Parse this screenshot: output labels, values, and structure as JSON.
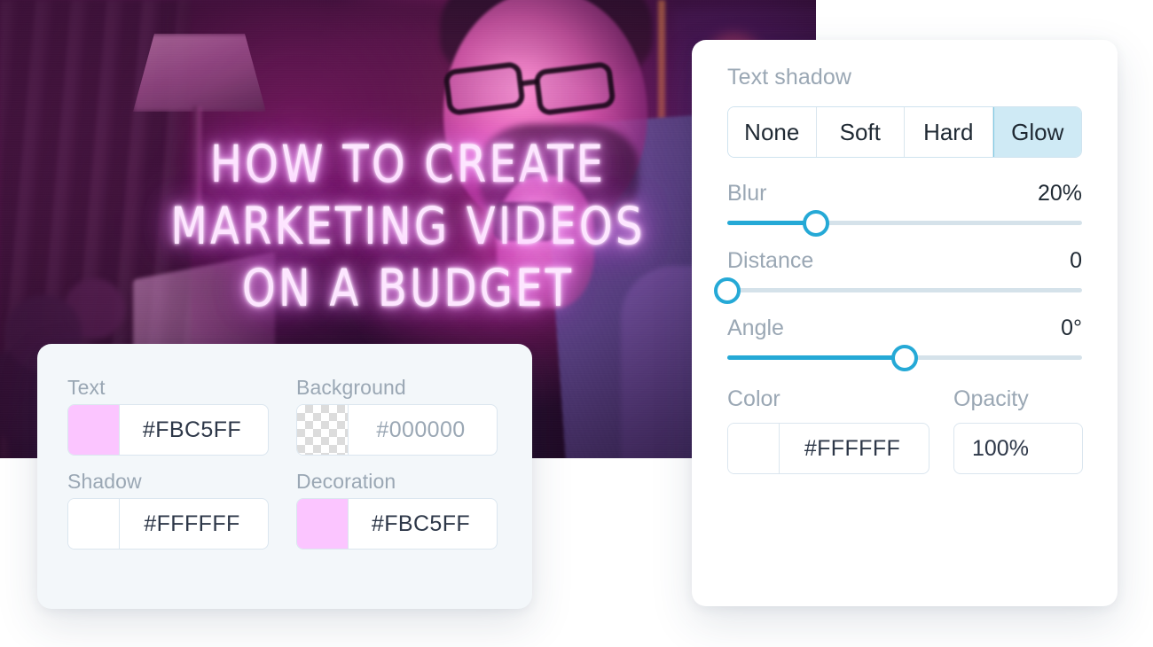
{
  "thumbnail": {
    "headline": "HOW TO CREATE\nMARKETING VIDEOS\nON A BUDGET",
    "headline_color": "#FBC5FF"
  },
  "color_panel": {
    "fields": [
      {
        "label": "Text",
        "value": "#FBC5FF",
        "swatch": "#FBC5FF",
        "swatch_kind": "solid",
        "placeholder": false
      },
      {
        "label": "Background",
        "value": "#000000",
        "swatch": "",
        "swatch_kind": "transparent",
        "placeholder": true
      },
      {
        "label": "Shadow",
        "value": "#FFFFFF",
        "swatch": "#FFFFFF",
        "swatch_kind": "solid",
        "placeholder": false
      },
      {
        "label": "Decoration",
        "value": "#FBC5FF",
        "swatch": "#FBC5FF",
        "swatch_kind": "solid",
        "placeholder": false
      }
    ]
  },
  "shadow_panel": {
    "title": "Text shadow",
    "segments": [
      {
        "label": "None",
        "active": false
      },
      {
        "label": "Soft",
        "active": false
      },
      {
        "label": "Hard",
        "active": false
      },
      {
        "label": "Glow",
        "active": true
      }
    ],
    "sliders": [
      {
        "name": "Blur",
        "value": "20%",
        "percent": 25
      },
      {
        "name": "Distance",
        "value": "0",
        "percent": 0
      },
      {
        "name": "Angle",
        "value": "0°",
        "percent": 50
      }
    ],
    "color": {
      "label": "Color",
      "value": "#FFFFFF",
      "swatch": "#FFFFFF"
    },
    "opacity": {
      "label": "Opacity",
      "value": "100%"
    },
    "accent_color": "#25A9D6",
    "active_segment_bg": "#CFEAF5"
  }
}
